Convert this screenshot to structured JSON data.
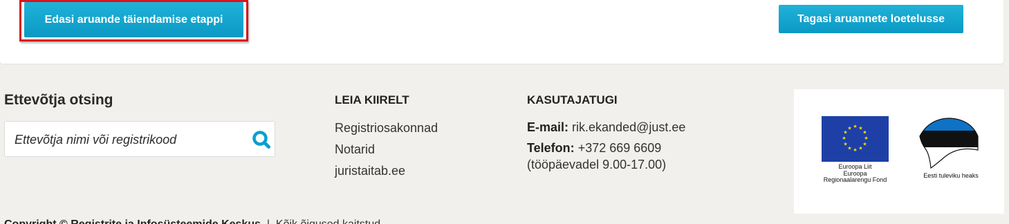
{
  "top": {
    "next_button": "Edasi aruande täiendamise etappi",
    "back_button": "Tagasi aruannete loetelusse"
  },
  "footer": {
    "search": {
      "title": "Ettevõtja otsing",
      "placeholder": "Ettevõtja nimi või registrikood",
      "icon": "search-icon"
    },
    "quick_links": {
      "title": "LEIA KIIRELT",
      "items": [
        "Registriosakonnad",
        "Notarid",
        "juristaitab.ee"
      ]
    },
    "support": {
      "title": "KASUTAJATUGI",
      "email_label": "E-mail:",
      "email_value": "rik.ekanded@just.ee",
      "phone_label": "Telefon:",
      "phone_value": "+372 669 6609",
      "hours": "(tööpäevadel 9.00-17.00)"
    },
    "logos": {
      "eu_caption": [
        "Euroopa Liit",
        "Euroopa",
        "Regionaalarengu Fond"
      ],
      "ee_caption": "Eesti tuleviku heaks"
    },
    "copyright": {
      "bold": "Copyright © Registrite ja Infosüsteemide Keskus",
      "separator": "|",
      "rights": "Kõik õigused kaitstud"
    }
  },
  "colors": {
    "accent": "#0fa6d1",
    "highlight_border": "#d9151b",
    "footer_bg": "#f1f0ec",
    "eu_blue": "#1e40a6"
  }
}
